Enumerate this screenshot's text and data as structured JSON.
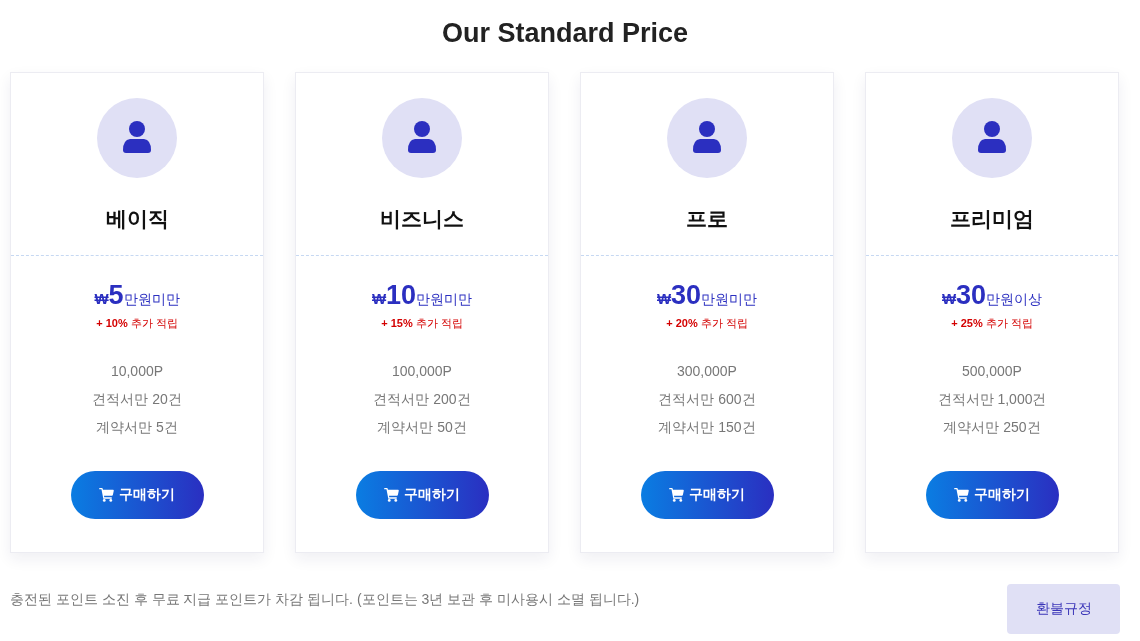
{
  "title": "Our Standard Price",
  "plans": [
    {
      "name": "베이직",
      "price": {
        "currency": "₩",
        "amount": "5",
        "unit": "만원미만"
      },
      "bonus": "**+ 10%** 추가 적립",
      "features": [
        "10,000P",
        "견적서만 20건",
        "계약서만 5건"
      ],
      "button": "구매하기"
    },
    {
      "name": "비즈니스",
      "price": {
        "currency": "₩",
        "amount": "10",
        "unit": "만원미만"
      },
      "bonus": "**+ 15%** 추가 적립",
      "features": [
        "100,000P",
        "견적서만 200건",
        "계약서만 50건"
      ],
      "button": "구매하기"
    },
    {
      "name": "프로",
      "price": {
        "currency": "₩",
        "amount": "30",
        "unit": "만원미만"
      },
      "bonus": "**+ 20%** 추가 적립",
      "features": [
        "300,000P",
        "견적서만 600건",
        "계약서만 150건"
      ],
      "button": "구매하기"
    },
    {
      "name": "프리미엄",
      "price": {
        "currency": "₩",
        "amount": "30",
        "unit": "만원이상"
      },
      "bonus": "**+ 25%** 추가 적립",
      "features": [
        "500,000P",
        "견적서만 1,000건",
        "계약서만 250건"
      ],
      "button": "구매하기"
    }
  ],
  "footer": {
    "note": "충전된 포인트 소진 후 무료 지급 포인트가 차감 됩니다. (포인트는 3년 보관 후 미사용시 소멸 됩니다.)",
    "button": "환불규정"
  }
}
